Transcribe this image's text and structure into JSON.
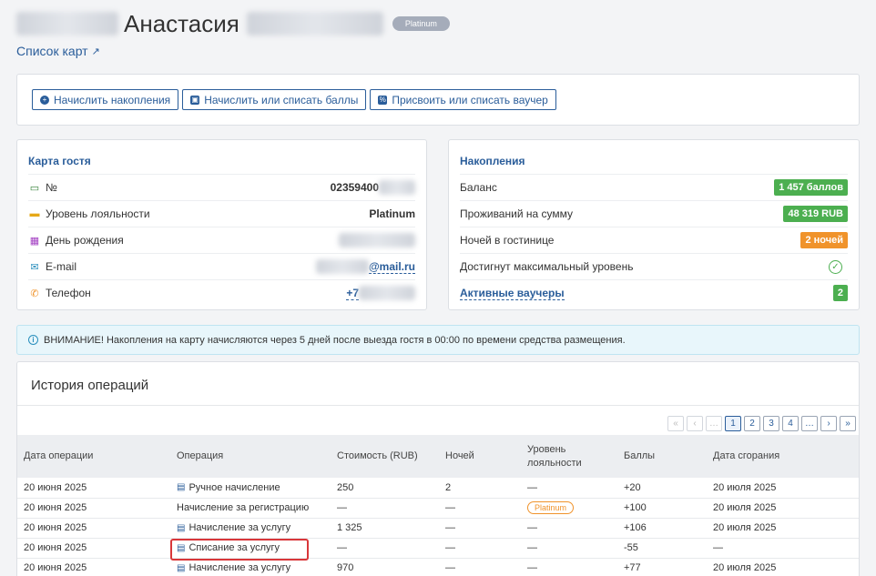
{
  "guest": {
    "first_name": "Анастасия",
    "tier": "Platinum",
    "cards_link": "Список карт"
  },
  "actions": [
    {
      "label": "Начислить накопления",
      "icon": "plus-circle-icon"
    },
    {
      "label": "Начислить или списать баллы",
      "icon": "wallet-icon"
    },
    {
      "label": "Присвоить или списать ваучер",
      "icon": "voucher-icon"
    }
  ],
  "card": {
    "title": "Карта гостя",
    "rows": [
      {
        "label": "№",
        "value": "02359400",
        "icon": "credit-card-icon",
        "color": "#2e7d32"
      },
      {
        "label": "Уровень лояльности",
        "value": "Platinum",
        "icon": "tier-icon",
        "color": "#e6a817"
      },
      {
        "label": "День рождения",
        "value": "",
        "icon": "gift-icon",
        "color": "#a23ec2"
      },
      {
        "label": "E-mail",
        "value": "@mail.ru",
        "icon": "mail-icon",
        "color": "#2a8fbd"
      },
      {
        "label": "Телефон",
        "value": "+7",
        "icon": "phone-icon",
        "color": "#f0932b"
      }
    ]
  },
  "accruals": {
    "title": "Накопления",
    "balance_label": "Баланс",
    "balance_value": "1 457 баллов",
    "stays_label": "Проживаний на сумму",
    "stays_value": "48 319 RUB",
    "nights_label": "Ночей в гостинице",
    "nights_value": "2 ночей",
    "max_label": "Достигнут максимальный уровень",
    "vouchers_label": "Активные ваучеры",
    "vouchers_value": "2"
  },
  "notice": "ВНИМАНИЕ! Накопления на карту начисляются через 5 дней после выезда гостя в 00:00 по времени средства размещения.",
  "history": {
    "title": "История операций",
    "pager": [
      "«",
      "‹",
      "…",
      "1",
      "2",
      "3",
      "4",
      "…",
      "›",
      "»"
    ],
    "active_page": "1",
    "columns": [
      "Дата операции",
      "Операция",
      "Стоимость (RUB)",
      "Ночей",
      "Уровень лояльности",
      "Баллы",
      "Дата сгорания"
    ],
    "rows": [
      {
        "date": "20 июня 2025",
        "op": "Ручное начисление",
        "has_comment": true,
        "cost": "250",
        "nights": "2",
        "tier": "—",
        "points": "+20",
        "expiry": "20 июля 2025"
      },
      {
        "date": "20 июня 2025",
        "op": "Начисление за регистрацию",
        "has_comment": false,
        "cost": "—",
        "nights": "—",
        "tier": "Platinum",
        "points": "+100",
        "expiry": "20 июля 2025"
      },
      {
        "date": "20 июня 2025",
        "op": "Начисление за услугу",
        "has_comment": true,
        "cost": "1 325",
        "nights": "—",
        "tier": "—",
        "points": "+106",
        "expiry": "20 июля 2025"
      },
      {
        "date": "20 июня 2025",
        "op": "Списание за услугу",
        "has_comment": true,
        "cost": "—",
        "nights": "—",
        "tier": "—",
        "points": "-55",
        "expiry": "—",
        "highlighted": true
      },
      {
        "date": "20 июня 2025",
        "op": "Начисление за услугу",
        "has_comment": true,
        "cost": "970",
        "nights": "—",
        "tier": "—",
        "points": "+77",
        "expiry": "20 июля 2025"
      }
    ]
  }
}
